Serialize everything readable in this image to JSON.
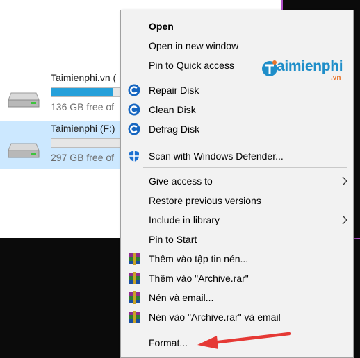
{
  "explorer": {
    "drives": [
      {
        "name": "Taimienphi.vn (",
        "free": "136 GB free of",
        "used_fraction": 0.82,
        "selected": false
      },
      {
        "name": "Taimienphi (F:)",
        "free": "297 GB free of",
        "used_fraction": 0.0,
        "selected": true
      }
    ]
  },
  "menu": {
    "open": "Open",
    "open_new_window": "Open in new window",
    "pin_quick_access": "Pin to Quick access",
    "repair_disk": "Repair Disk",
    "clean_disk": "Clean Disk",
    "defrag_disk": "Defrag Disk",
    "scan_defender": "Scan with Windows Defender...",
    "give_access": "Give access to",
    "restore_versions": "Restore previous versions",
    "include_library": "Include in library",
    "pin_start": "Pin to Start",
    "them_vao_tap_tin": "Thêm vào tập tin nén...",
    "them_vao_archive": "Thêm vào \"Archive.rar\"",
    "nen_email": "Nén và email...",
    "nen_vao_archive_email": "Nén vào \"Archive.rar\" và email",
    "format": "Format..."
  },
  "watermark": {
    "brand": "aimienphi",
    "tld": ".vn"
  },
  "colors": {
    "accent_arrow": "#e53935",
    "drive_bar": "#26a0da",
    "selection": "#cce8ff",
    "brand_blue": "#1f8ec9"
  }
}
